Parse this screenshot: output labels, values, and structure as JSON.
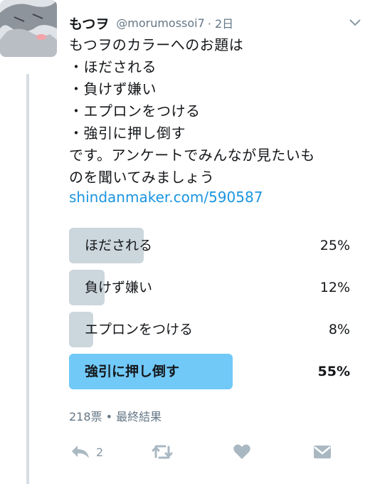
{
  "tweet": {
    "display_name": "もつヲ",
    "handle": "@morumossoi7",
    "time": "· 2日",
    "text_lines": [
      "もつヲのカラーへのお題は",
      "・ほだされる",
      "・負けず嫌い",
      "・エプロンをつける",
      "・強引に押し倒す",
      "です。アンケートでみんなが見たいも",
      "のを聞いてみましょう"
    ],
    "link": "shindanmaker.com/590587"
  },
  "poll": {
    "options": [
      {
        "label": "ほだされる",
        "percent_text": "25%",
        "percent": 25,
        "winner": false
      },
      {
        "label": "負けず嫌い",
        "percent_text": "12%",
        "percent": 12,
        "winner": false
      },
      {
        "label": "エプロンをつける",
        "percent_text": "8%",
        "percent": 8,
        "winner": false
      },
      {
        "label": "強引に押し倒す",
        "percent_text": "55%",
        "percent": 55,
        "winner": true
      }
    ],
    "summary": "218票 • 最終結果"
  },
  "actions": {
    "reply_count": "2",
    "icons": [
      "reply-icon",
      "retweet-icon",
      "like-icon",
      "dm-icon"
    ]
  },
  "colors": {
    "link": "#1b95e0",
    "winner_bar": "#71c9f8",
    "bar": "#ccd6dd",
    "muted": "#657786"
  }
}
